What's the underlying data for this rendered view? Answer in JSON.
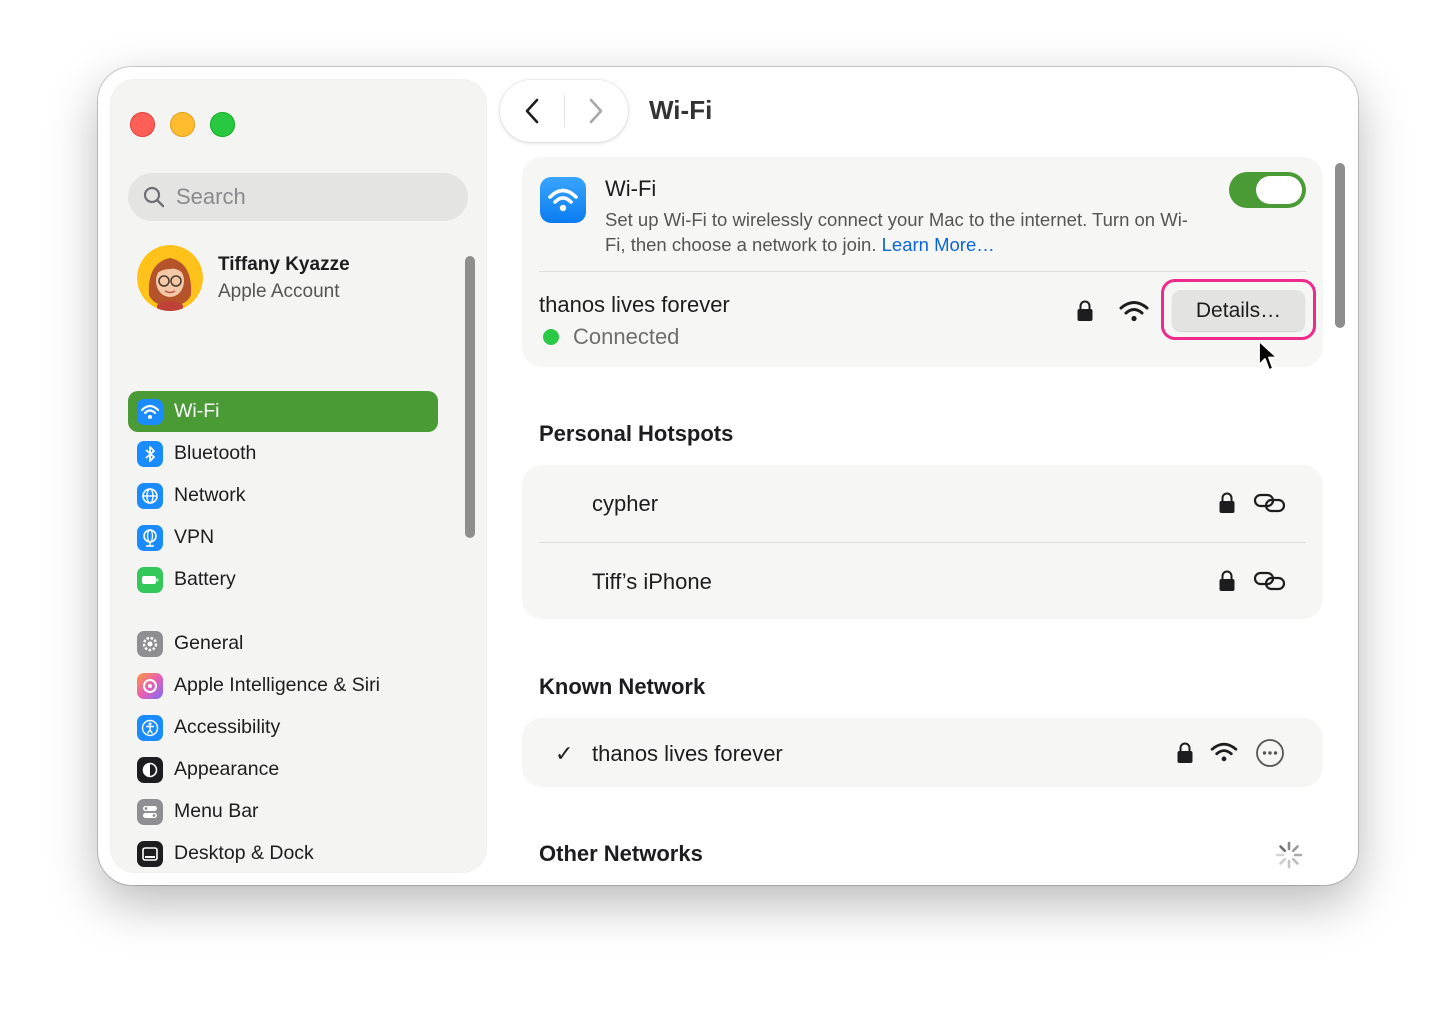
{
  "window": {
    "title": "Wi-Fi"
  },
  "sidebar": {
    "search_placeholder": "Search",
    "account": {
      "name": "Tiffany Kyazze",
      "subtitle": "Apple Account"
    },
    "items": [
      {
        "label": "Wi-Fi",
        "icon": "wifi-icon",
        "color": "#1a8cff",
        "active": true
      },
      {
        "label": "Bluetooth",
        "icon": "bluetooth-icon",
        "color": "#1a8cff"
      },
      {
        "label": "Network",
        "icon": "globe-icon",
        "color": "#1a8cff"
      },
      {
        "label": "VPN",
        "icon": "vpn-globe-icon",
        "color": "#1a8cff"
      },
      {
        "label": "Battery",
        "icon": "battery-icon",
        "color": "#34c759"
      },
      {
        "label": "General",
        "icon": "gear-icon",
        "color": "#8e8e93"
      },
      {
        "label": "Apple Intelligence & Siri",
        "icon": "siri-icon",
        "color": "#e85fb0"
      },
      {
        "label": "Accessibility",
        "icon": "accessibility-icon",
        "color": "#1a8cff"
      },
      {
        "label": "Appearance",
        "icon": "appearance-icon",
        "color": "#1d1d1f"
      },
      {
        "label": "Menu Bar",
        "icon": "menubar-icon",
        "color": "#8e8e93"
      },
      {
        "label": "Desktop & Dock",
        "icon": "dock-icon",
        "color": "#1d1d1f"
      }
    ]
  },
  "wifi": {
    "title": "Wi-Fi",
    "description": "Set up Wi-Fi to wirelessly connect your Mac to the internet. Turn on Wi-Fi, then choose a network to join.",
    "learn_more": "Learn More…",
    "enabled": true,
    "current_network": {
      "name": "thanos lives forever",
      "status": "Connected"
    },
    "details_button": "Details…"
  },
  "personal_hotspots": {
    "title": "Personal Hotspots",
    "items": [
      {
        "name": "cypher"
      },
      {
        "name": "Tiff’s iPhone"
      }
    ]
  },
  "known_networks": {
    "title": "Known Network",
    "items": [
      {
        "name": "thanos lives forever",
        "checked": true
      }
    ]
  },
  "other_networks": {
    "title": "Other Networks"
  },
  "colors": {
    "accent": "#4a9a35",
    "link": "#0a66d8",
    "highlight": "#ee2a8a",
    "connected": "#2ac845"
  }
}
